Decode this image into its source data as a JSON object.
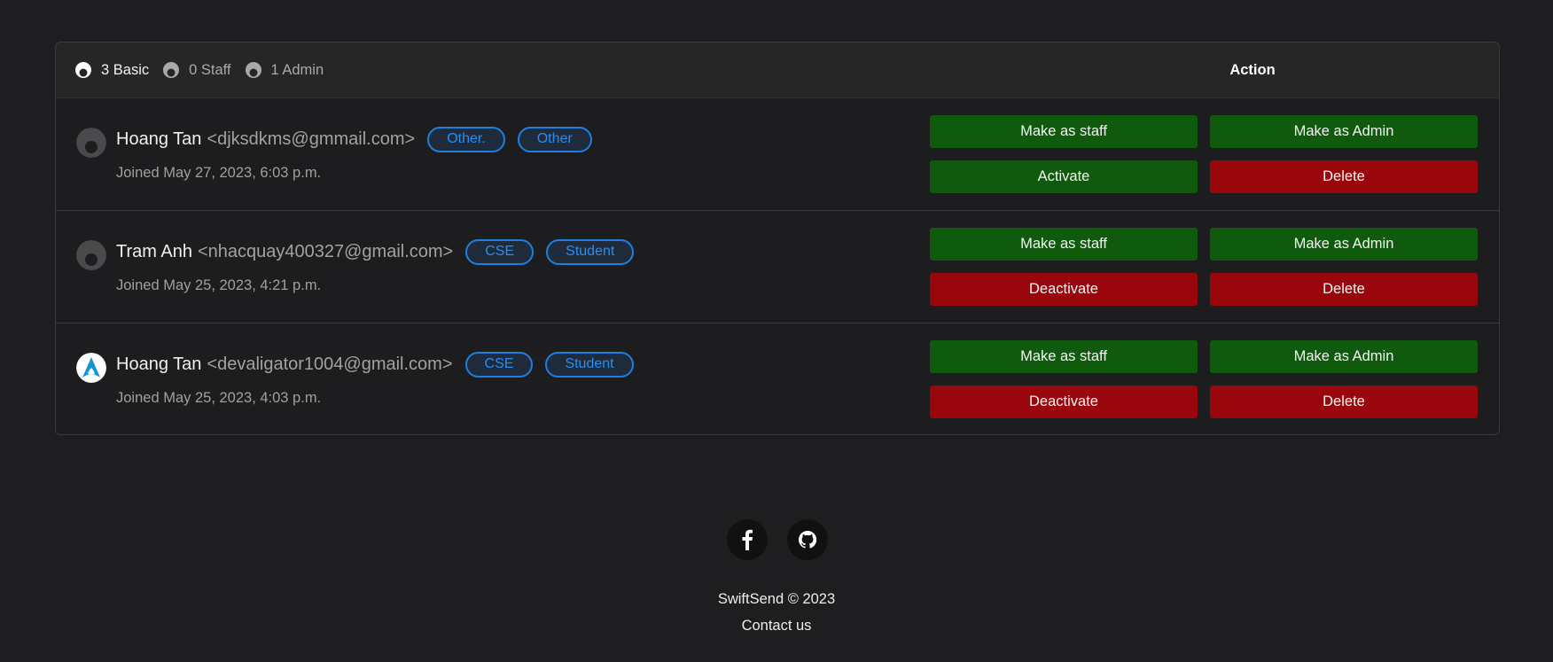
{
  "filters": [
    {
      "label": "3 Basic",
      "icon": "user-icon",
      "active": true
    },
    {
      "label": "0 Staff",
      "icon": "user-icon",
      "active": false
    },
    {
      "label": "1 Admin",
      "icon": "user-icon",
      "active": false
    }
  ],
  "table": {
    "action_header": "Action"
  },
  "users": [
    {
      "name": "Hoang Tan",
      "email": "<djksdkms@gmmail.com>",
      "tags": [
        "Other.",
        "Other"
      ],
      "joined": "Joined May 27, 2023, 6:03 p.m.",
      "avatar": "default-avatar-icon",
      "actions": {
        "staff": "Make as staff",
        "admin": "Make as Admin",
        "toggle": "Activate",
        "delete": "Delete"
      }
    },
    {
      "name": "Tram Anh",
      "email": "<nhacquay400327@gmail.com>",
      "tags": [
        "CSE",
        "Student"
      ],
      "joined": "Joined May 25, 2023, 4:21 p.m.",
      "avatar": "default-avatar-icon",
      "actions": {
        "staff": "Make as staff",
        "admin": "Make as Admin",
        "toggle": "Deactivate",
        "delete": "Delete"
      }
    },
    {
      "name": "Hoang Tan",
      "email": "<devaligator1004@gmail.com>",
      "tags": [
        "CSE",
        "Student"
      ],
      "joined": "Joined May 25, 2023, 4:03 p.m.",
      "avatar": "arch-logo-avatar-icon",
      "actions": {
        "staff": "Make as staff",
        "admin": "Make as Admin",
        "toggle": "Deactivate",
        "delete": "Delete"
      }
    }
  ],
  "footer": {
    "social": [
      "facebook-icon",
      "github-icon"
    ],
    "copyright": "SwiftSend © 2023",
    "contact": "Contact us"
  },
  "colors": {
    "green": "#0f5a0c",
    "red": "#99070c",
    "tag": "#1f7fe0",
    "bg": "#1e1e20"
  }
}
